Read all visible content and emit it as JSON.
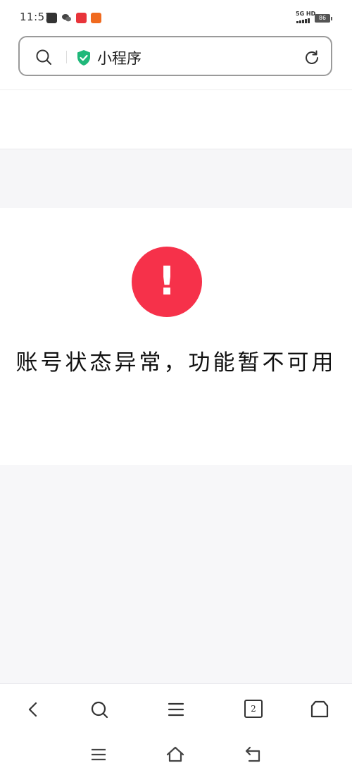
{
  "status_bar": {
    "time": "11:51",
    "network": "5G HD",
    "battery": "86",
    "notification_icons": [
      "tiktok-icon",
      "wechat-icon",
      "app-icon-red",
      "app-icon-orange"
    ]
  },
  "address_bar": {
    "text": "小程序",
    "security_icon": "shield-check-icon"
  },
  "content": {
    "error_symbol": "!",
    "message": "账号状态异常，功能暂不可用"
  },
  "toolbar": {
    "tab_count": "2",
    "icons": [
      "back-icon",
      "search-icon",
      "menu-icon",
      "tabs-icon",
      "home-icon"
    ]
  },
  "nav": {
    "icons": [
      "recent-apps-icon",
      "home-icon",
      "back-icon"
    ]
  },
  "colors": {
    "accent_red": "#f6314a",
    "shield_green": "#1fb87a"
  }
}
